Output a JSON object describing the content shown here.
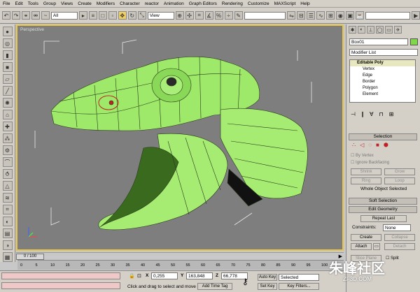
{
  "menu": [
    "File",
    "Edit",
    "Tools",
    "Group",
    "Views",
    "Create",
    "Modifiers",
    "Character",
    "reactor",
    "Animation",
    "Graph Editors",
    "Rendering",
    "Customize",
    "MAXScript",
    "Help"
  ],
  "toolbar": {
    "filter_value": "All",
    "refcoord_value": "View"
  },
  "viewport": {
    "label": "Perspective"
  },
  "command_panel": {
    "object_name": "Box01",
    "object_color": "#7ed848",
    "modifier_list": "Modifier List",
    "stack": [
      "Editable Poly",
      "Vertex",
      "Edge",
      "Border",
      "Polygon",
      "Element"
    ],
    "selection": {
      "title": "Selection",
      "by_vertex": "By Vertex",
      "ignore_backfacing": "Ignore Backfacing",
      "shrink": "Shrink",
      "grow": "Grow",
      "ring": "Ring",
      "loop": "Loop",
      "status": "Whole Object Selected"
    },
    "soft_selection": "Soft Selection",
    "edit_geometry": {
      "title": "Edit Geometry",
      "repeat_last": "Repeat Last",
      "constraints_label": "Constraints:",
      "constraints_value": "None",
      "create": "Create",
      "collapse": "Collapse",
      "attach": "Attach",
      "detach": "Detach",
      "slice_plane": "Slice Plane",
      "split": "Split"
    }
  },
  "timeline": {
    "slider": "0 / 100",
    "ticks": [
      "0",
      "5",
      "10",
      "15",
      "20",
      "25",
      "30",
      "35",
      "40",
      "45",
      "50",
      "55",
      "60",
      "65",
      "70",
      "75",
      "80",
      "85",
      "90",
      "95",
      "100"
    ]
  },
  "status": {
    "x_label": "X",
    "x_value": "0,255",
    "y_label": "Y",
    "y_value": "163,848",
    "z_label": "Z",
    "z_value": "66,778",
    "prompt": "Click and drag to select and move",
    "add_time_tag": "Add Time Tag",
    "auto_key": "Auto Key",
    "set_key": "Set Key",
    "selected": "Selected",
    "key_filters": "Key Filters..."
  },
  "watermark": "朱峰社区",
  "watermark_url": "ZF3D.COM"
}
